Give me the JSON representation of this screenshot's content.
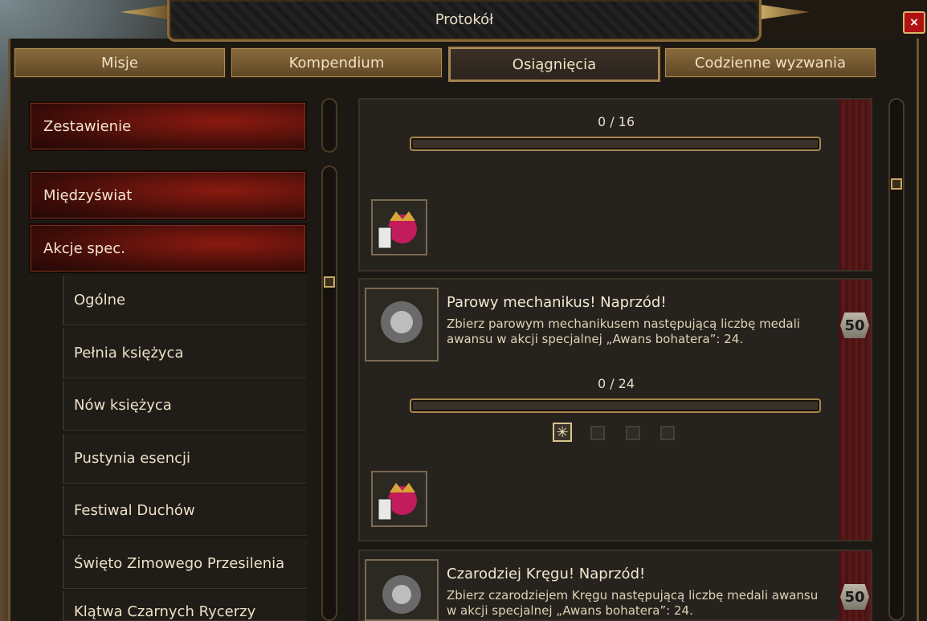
{
  "window": {
    "title": "Protokół",
    "close_label": "×"
  },
  "tabs": [
    {
      "label": "Misje"
    },
    {
      "label": "Kompendium"
    },
    {
      "label": "Osiągnięcia"
    },
    {
      "label": "Codzienne wyzwania"
    }
  ],
  "active_tab": "Osiągnięcia",
  "sidebar": {
    "summary": "Zestawienie",
    "categories": [
      "Międzyświat",
      "Akcje spec."
    ],
    "subitems": [
      "Ogólne",
      "Pełnia księżyca",
      "Nów księżyca",
      "Pustynia esencji",
      "Festiwal Duchów",
      "Święto Zimowego Przesilenia",
      "Klątwa Czarnych Rycerzy"
    ]
  },
  "achievements": [
    {
      "progress": "0 / 16",
      "progress_fraction": 0
    },
    {
      "title": "Parowy mechanikus! Naprzód!",
      "description": "Zbierz parowym mechanikusem następującą liczbę medali awansu w akcji specjalnej „Awans bohatera”: 24.",
      "progress": "0 / 24",
      "progress_fraction": 0,
      "points": "50",
      "tiers_completed": 1,
      "tiers_total": 4
    },
    {
      "title": "Czarodziej Kręgu! Naprzód!",
      "description": "Zbierz czarodziejem Kręgu następującą liczbę medali awansu w akcji specjalnej „Awans bohatera”: 24.",
      "points": "50"
    }
  ]
}
